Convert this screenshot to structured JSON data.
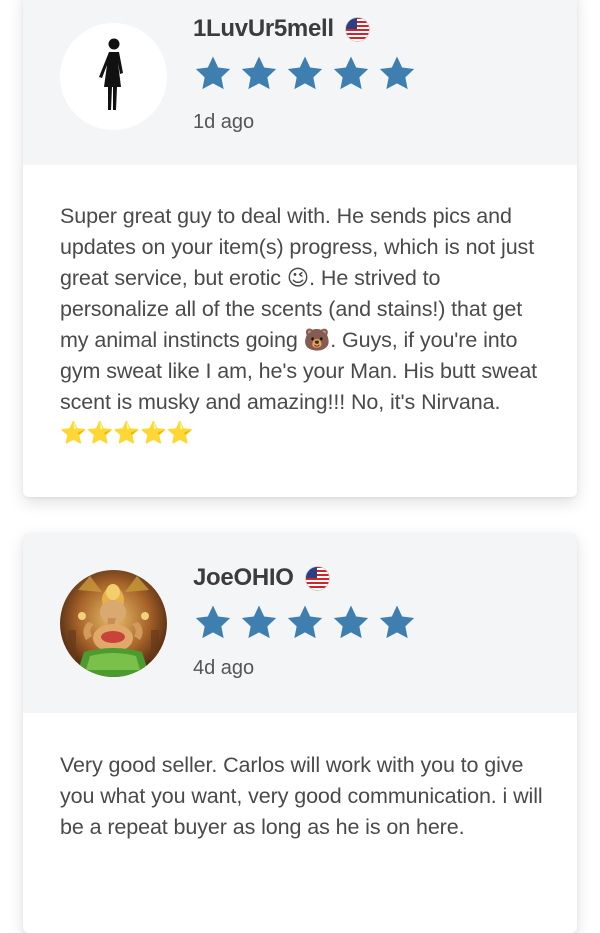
{
  "reviews": [
    {
      "reviewer": "1LuvUr5mell",
      "country_flag": "us-flag-icon",
      "rating": 5,
      "date": "1d ago",
      "text_parts": [
        "Super great guy to deal with. He sends pics and updates on your item(s) progress, which is not just great service, but erotic ",
        "😉",
        ". He strived to personalize all of the scents (and stains!) that get my animal instincts going ",
        "🐻",
        ". Guys, if you're into gym sweat like I am, he's your Man. His butt sweat scent is musky and amazing!!! No, it's Nirvana. ",
        "⭐⭐⭐⭐⭐"
      ]
    },
    {
      "reviewer": "JoeOHIO",
      "country_flag": "us-flag-icon",
      "rating": 5,
      "date": "4d ago",
      "text_parts": [
        "Very good seller. Carlos will work with you to give you what you want, very good communication. i will be a repeat buyer as long as he is on here."
      ]
    }
  ],
  "colors": {
    "star": "#3f7fb0",
    "header_bg": "#f4f5f7",
    "name": "#3c3c3c",
    "body_text": "#4a4a4a"
  }
}
